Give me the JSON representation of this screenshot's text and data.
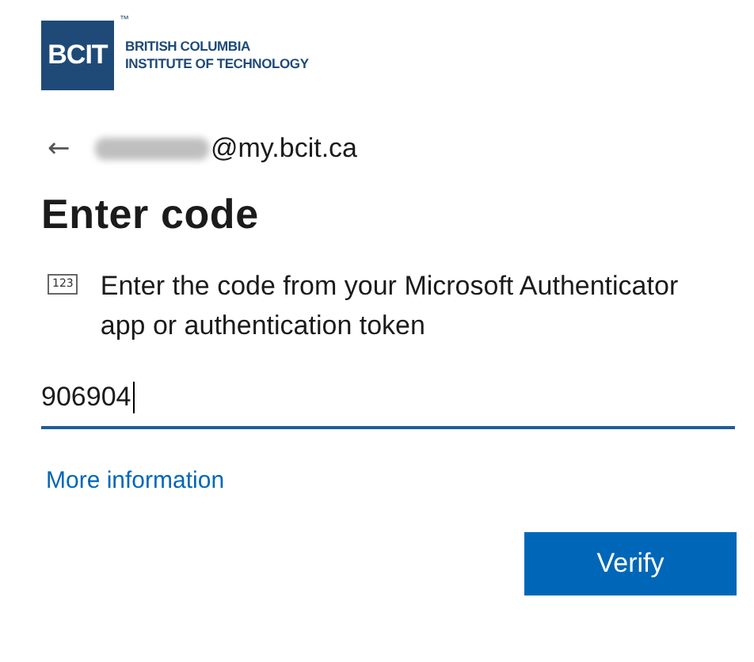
{
  "logo": {
    "mark": "BCIT",
    "trademark": "™",
    "lines": [
      "BRITISH COLUMBIA",
      "INSTITUTE OF TECHNOLOGY"
    ]
  },
  "account": {
    "back": "←",
    "email": "@my.bcit.ca",
    "redacted": true
  },
  "title": "Enter code",
  "prompt": {
    "icon_text": "123",
    "text": "Enter the code from your Microsoft Authenticator app or authentication token"
  },
  "code_field": {
    "value": "906904",
    "focused": true
  },
  "link": "More information",
  "buttons": [
    "Verify"
  ]
}
